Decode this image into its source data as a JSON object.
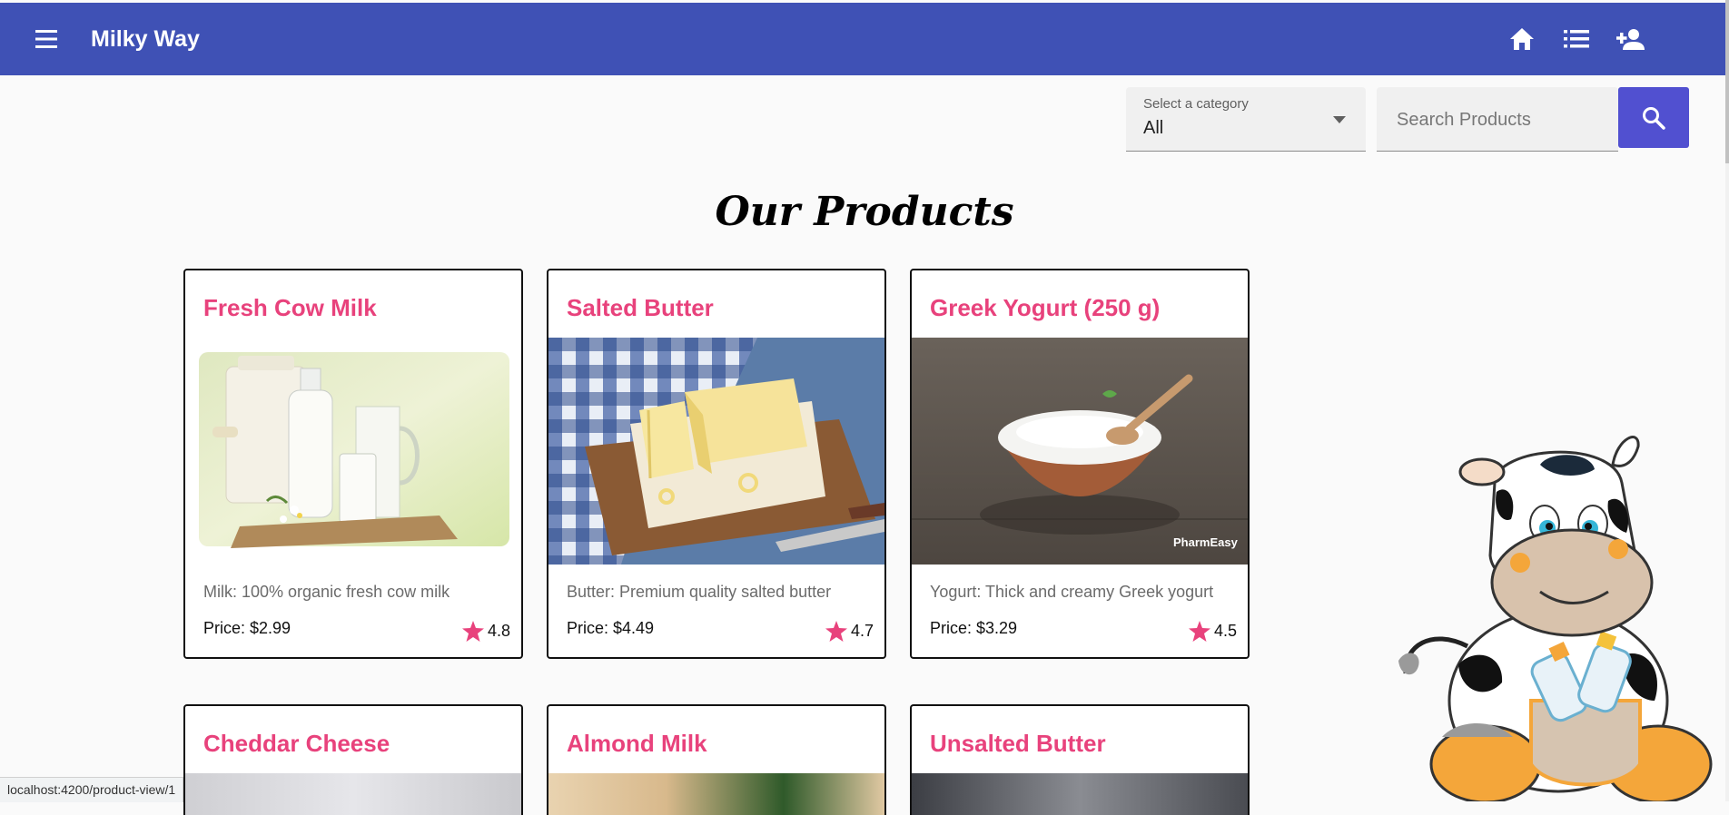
{
  "app": {
    "title": "Milky Way"
  },
  "toolbar": {
    "menu_icon": "menu-icon",
    "icons": [
      "home-icon",
      "list-icon",
      "person-add-icon"
    ]
  },
  "filters": {
    "category_label": "Select a category",
    "category_value": "All",
    "search_placeholder": "Search Products",
    "search_icon": "search-icon"
  },
  "section": {
    "title": "Our Products"
  },
  "products": [
    {
      "name": "Fresh Cow Milk",
      "description": "Milk: 100% organic fresh cow milk",
      "price": "Price: $2.99",
      "rating": "4.8"
    },
    {
      "name": "Salted Butter",
      "description": "Butter: Premium quality salted butter",
      "price": "Price: $4.49",
      "rating": "4.7"
    },
    {
      "name": "Greek Yogurt (250 g)",
      "description": "Yogurt: Thick and creamy Greek yogurt",
      "price": "Price: $3.29",
      "rating": "4.5"
    },
    {
      "name": "Cheddar Cheese"
    },
    {
      "name": "Almond Milk"
    },
    {
      "name": "Unsalted Butter"
    }
  ],
  "image_watermark": "PharmEasy",
  "status": {
    "url": "localhost:4200/product-view/1"
  },
  "colors": {
    "primary": "#3f51b5",
    "accent": "#e8427c",
    "search_button": "#5150d0"
  }
}
